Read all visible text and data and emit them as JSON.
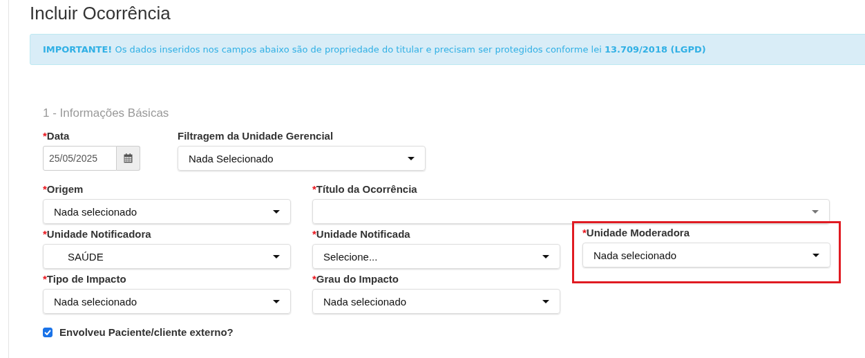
{
  "page_title": "Incluir Ocorrência",
  "alert": {
    "text": "**IMPORTANTE!** Os dados inseridos nos campos abaixo são de propriedade do titular e precisam ser protegidos conforme lei **13.709/2018 (LGPD)**"
  },
  "section_title": "1 - Informações Básicas",
  "rows": [
    [
      {
        "kind": "date",
        "marker": "*",
        "label": "Data",
        "value": "25/05/2025",
        "highlighted": false
      },
      {
        "kind": "select",
        "label": "Filtragem da Unidade Gerencial",
        "value": "Nada Selecionado",
        "highlighted": false
      }
    ],
    [
      {
        "kind": "select",
        "marker": "*",
        "label": "Origem",
        "value": "Nada selecionado",
        "highlighted": false
      },
      {
        "kind": "combo",
        "marker": "*",
        "label": "Título da Ocorrência",
        "highlighted": false
      }
    ],
    [
      {
        "kind": "select",
        "marker": "*",
        "label": "Unidade Notificadora",
        "value": "SAÚDE",
        "highlighted": false
      },
      {
        "kind": "select",
        "marker": "*",
        "label": "Unidade Notificada",
        "value": "Selecione...",
        "highlighted": false
      },
      {
        "kind": "select",
        "marker": "*",
        "label": "Unidade Moderadora",
        "value": "Nada selecionado",
        "highlighted": true
      }
    ],
    [
      {
        "kind": "select",
        "marker": "*",
        "label": "Tipo de Impacto",
        "value": "Nada selecionado",
        "highlighted": false
      },
      {
        "kind": "select",
        "marker": "*",
        "label": "Grau do Impacto",
        "value": "Nada selecionado",
        "highlighted": false
      }
    ]
  ],
  "checkbox": {
    "label": "Envolveu Paciente/cliente externo?",
    "checked": true
  }
}
